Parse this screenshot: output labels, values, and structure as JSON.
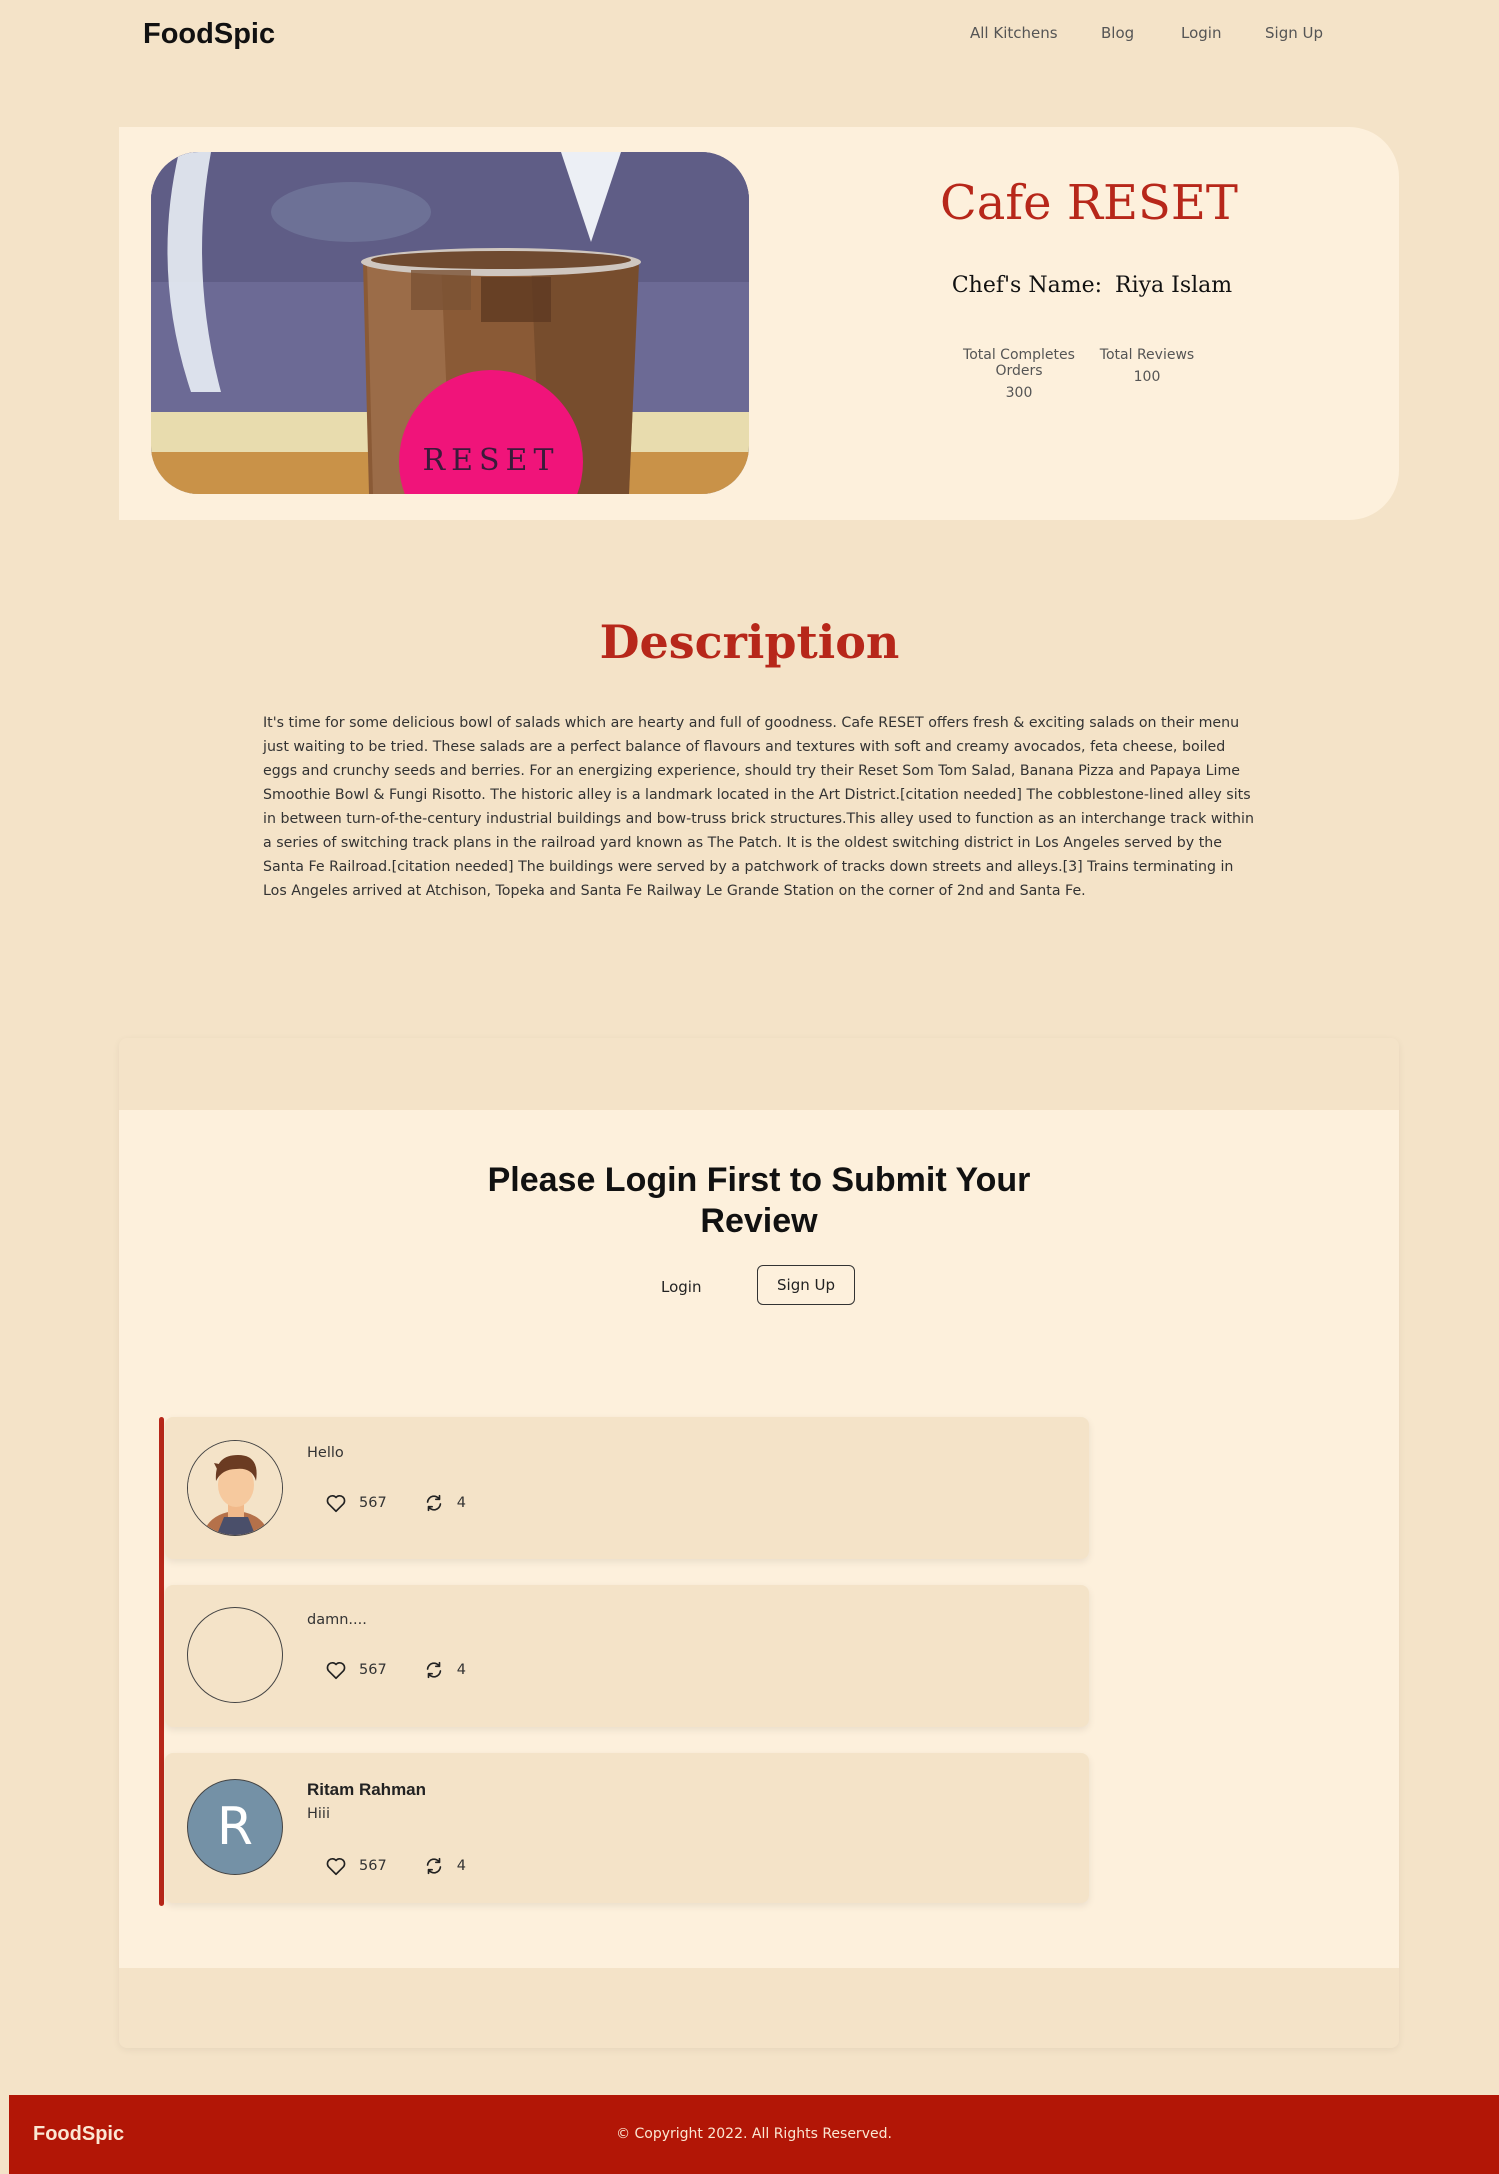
{
  "nav": {
    "brand": "FoodSpic",
    "links": [
      "All Kitchens",
      "Blog",
      "Login",
      "Sign Up"
    ]
  },
  "kitchen": {
    "name": "Cafe RESET",
    "chef_label": "Chef's Name:",
    "chef_name": "Riya Islam",
    "stats": [
      {
        "label": "Total Completes Orders",
        "value": "300"
      },
      {
        "label": "Total Reviews",
        "value": "100"
      }
    ],
    "image_text": "RESET"
  },
  "description": {
    "title": "Description",
    "text": "It's time for some delicious bowl of salads which are hearty and full of goodness. Cafe RESET offers fresh & exciting salads on their menu just waiting to be tried. These salads are a perfect balance of flavours and textures with soft and creamy avocados, feta cheese, boiled eggs and crunchy seeds and berries. For an energizing experience, should try their Reset Som Tom Salad, Banana Pizza and Papaya Lime Smoothie Bowl & Fungi Risotto. The historic alley is a landmark located in the Art District.[citation needed] The cobblestone-lined alley sits in between turn-of-the-century industrial buildings and bow-truss brick structures.This alley used to function as an interchange track within a series of switching track plans in the railroad yard known as The Patch. It is the oldest switching district in Los Angeles served by the Santa Fe Railroad.[citation needed] The buildings were served by a patchwork of tracks down streets and alleys.[3] Trains terminating in Los Angeles arrived at Atchison, Topeka and Santa Fe Railway Le Grande Station on the corner of 2nd and Santa Fe."
  },
  "review_section": {
    "prompt": "Please Login First to Submit Your Review",
    "login_label": "Login",
    "signup_label": "Sign Up",
    "reviews": [
      {
        "name": "",
        "text": "Hello",
        "likes": "567",
        "shares": "4",
        "avatar": "cartoon-man"
      },
      {
        "name": "",
        "text": "damn....",
        "likes": "567",
        "shares": "4",
        "avatar": "empty"
      },
      {
        "name": "Ritam Rahman",
        "text": "Hiii",
        "likes": "567",
        "shares": "4",
        "avatar_letter": "R"
      }
    ]
  },
  "footer": {
    "brand": "FoodSpic",
    "copyright": "© Copyright 2022. All Rights Reserved."
  },
  "colors": {
    "page_bg": "#f4e3c8",
    "card_bg": "#fdf0dc",
    "accent_red": "#b7271a",
    "footer_red": "#b21606",
    "avatar_blue": "#7491a6"
  }
}
